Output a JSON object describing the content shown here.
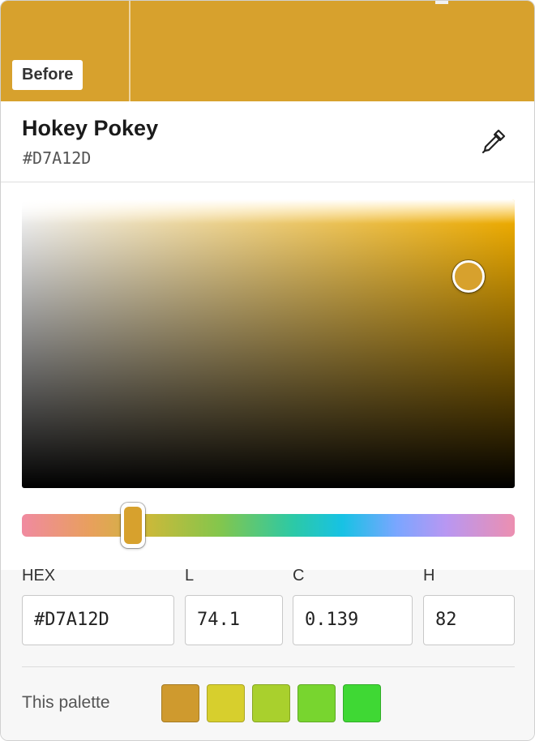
{
  "header": {
    "before_label": "Before",
    "swatch_color": "#D7A12D"
  },
  "color": {
    "name": "Hokey Pokey",
    "hex": "#D7A12D"
  },
  "icons": {
    "picker": "eyedropper-icon"
  },
  "picker": {
    "hue_gradient": "oklch hue spectrum"
  },
  "fields": {
    "hex_label": "HEX",
    "hex_value": "#D7A12D",
    "l_label": "L",
    "l_value": "74.1",
    "c_label": "C",
    "c_value": "0.139",
    "h_label": "H",
    "h_value": "82"
  },
  "palette": {
    "label": "This palette",
    "swatches": [
      "#CF9A2E",
      "#D7CF2D",
      "#A9D02D",
      "#78D52F",
      "#3FD834"
    ]
  }
}
